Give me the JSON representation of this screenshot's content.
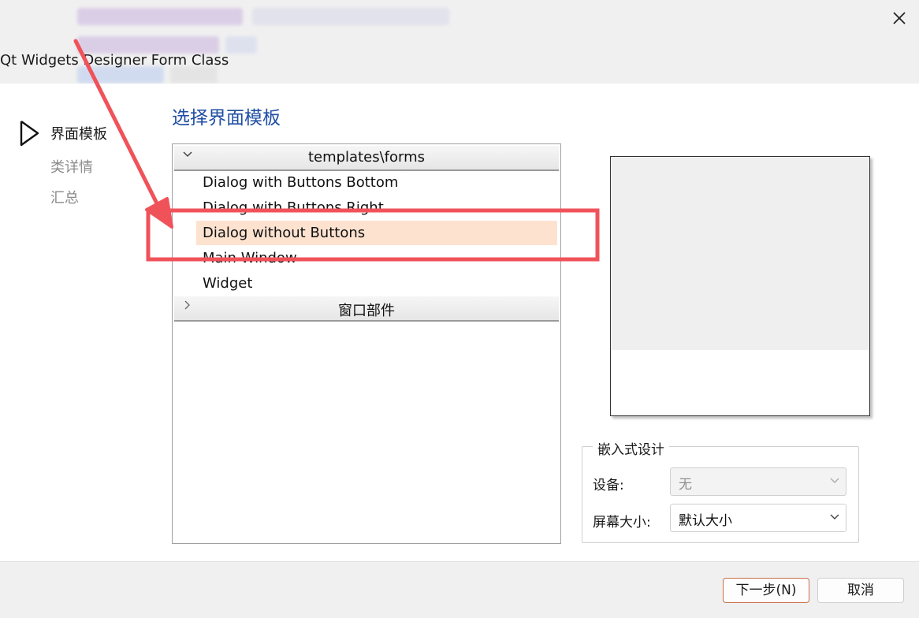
{
  "window": {
    "title": "Qt Widgets Designer Form Class",
    "close_icon": "close-icon"
  },
  "sidebar": {
    "steps": [
      {
        "label": "界面模板",
        "state": "active"
      },
      {
        "label": "类详情",
        "state": "inactive"
      },
      {
        "label": "汇总",
        "state": "inactive"
      }
    ]
  },
  "main": {
    "heading": "选择界面模板",
    "tree": {
      "groups": [
        {
          "title": "templates\\forms",
          "expanded": true,
          "items": [
            {
              "label": "Dialog with Buttons Bottom",
              "selected": false
            },
            {
              "label": "Dialog with Buttons Right",
              "selected": false
            },
            {
              "label": "Dialog without Buttons",
              "selected": true
            },
            {
              "label": "Main Window",
              "selected": false
            },
            {
              "label": "Widget",
              "selected": false
            }
          ]
        },
        {
          "title": "窗口部件",
          "expanded": false,
          "items": []
        }
      ]
    }
  },
  "embedded_design": {
    "title": "嵌入式设计",
    "device_label": "设备:",
    "device_value": "无",
    "screen_size_label": "屏幕大小:",
    "screen_size_value": "默认大小"
  },
  "footer": {
    "next_label": "下一步(N)",
    "cancel_label": "取消"
  },
  "colors": {
    "heading": "#1f4ea3",
    "selection": "#fde2d0",
    "annotation": "#f0525a",
    "primary_border": "#c87048"
  }
}
